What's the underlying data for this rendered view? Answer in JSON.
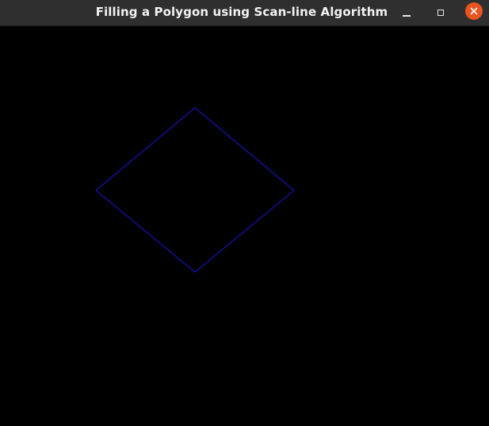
{
  "window": {
    "title": "Filling a Polygon using Scan-line Algorithm"
  },
  "controls": {
    "minimize_icon": "minimize-icon",
    "maximize_icon": "maximize-icon",
    "close_icon": "close-icon"
  },
  "colors": {
    "titlebar_bg": "#2f2f2f",
    "close_button": "#e95420",
    "canvas_bg": "#000000",
    "polygon_stroke": "#1414a8"
  }
}
